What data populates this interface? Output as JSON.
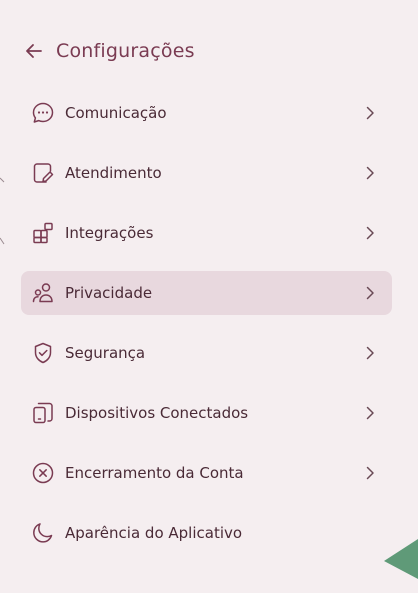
{
  "header": {
    "title": "Configurações",
    "back_icon": "arrow-left-icon"
  },
  "menu": {
    "items": [
      {
        "label": "Comunicação",
        "icon": "chat-bubble-icon",
        "has_chevron": true,
        "active": false
      },
      {
        "label": "Atendimento",
        "icon": "document-edit-icon",
        "has_chevron": true,
        "active": false
      },
      {
        "label": "Integrações",
        "icon": "grid-add-icon",
        "has_chevron": true,
        "active": false
      },
      {
        "label": "Privacidade",
        "icon": "users-icon",
        "has_chevron": true,
        "active": true
      },
      {
        "label": "Segurança",
        "icon": "shield-check-icon",
        "has_chevron": true,
        "active": false
      },
      {
        "label": "Dispositivos Conectados",
        "icon": "devices-icon",
        "has_chevron": true,
        "active": false
      },
      {
        "label": "Encerramento da Conta",
        "icon": "circle-x-icon",
        "has_chevron": true,
        "active": false
      },
      {
        "label": "Aparência do Aplicativo",
        "icon": "moon-icon",
        "has_chevron": false,
        "active": false
      }
    ]
  },
  "colors": {
    "background": "#f5eef0",
    "accent": "#7a3b52",
    "active_bg": "#e8d8de",
    "text": "#4a2a36",
    "corner_green": "#5f9a78"
  }
}
